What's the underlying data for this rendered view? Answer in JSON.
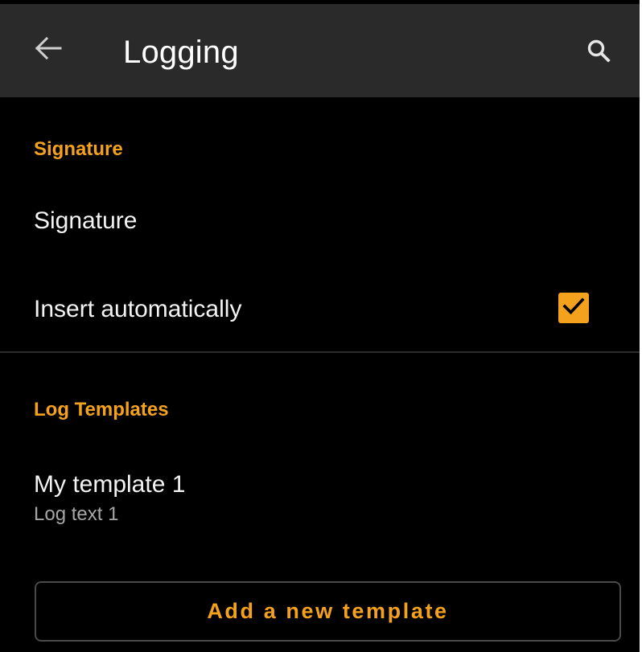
{
  "app_bar": {
    "title": "Logging",
    "back_icon": "arrow-left-icon",
    "search_icon": "search-icon"
  },
  "sections": {
    "signature": {
      "header": "Signature",
      "signature_item": {
        "title": "Signature"
      },
      "insert_item": {
        "title": "Insert automatically",
        "checked": true
      }
    },
    "log_templates": {
      "header": "Log Templates",
      "template_item": {
        "title": "My template 1",
        "summary": "Log text 1"
      },
      "add_button_label": "Add a new template"
    }
  },
  "colors": {
    "accent": "#f4a11d",
    "app_bar_bg": "#2a2a2a",
    "screen_bg": "#000000",
    "primary_text": "#f3f3f3",
    "secondary_text": "#a6a6a6"
  }
}
